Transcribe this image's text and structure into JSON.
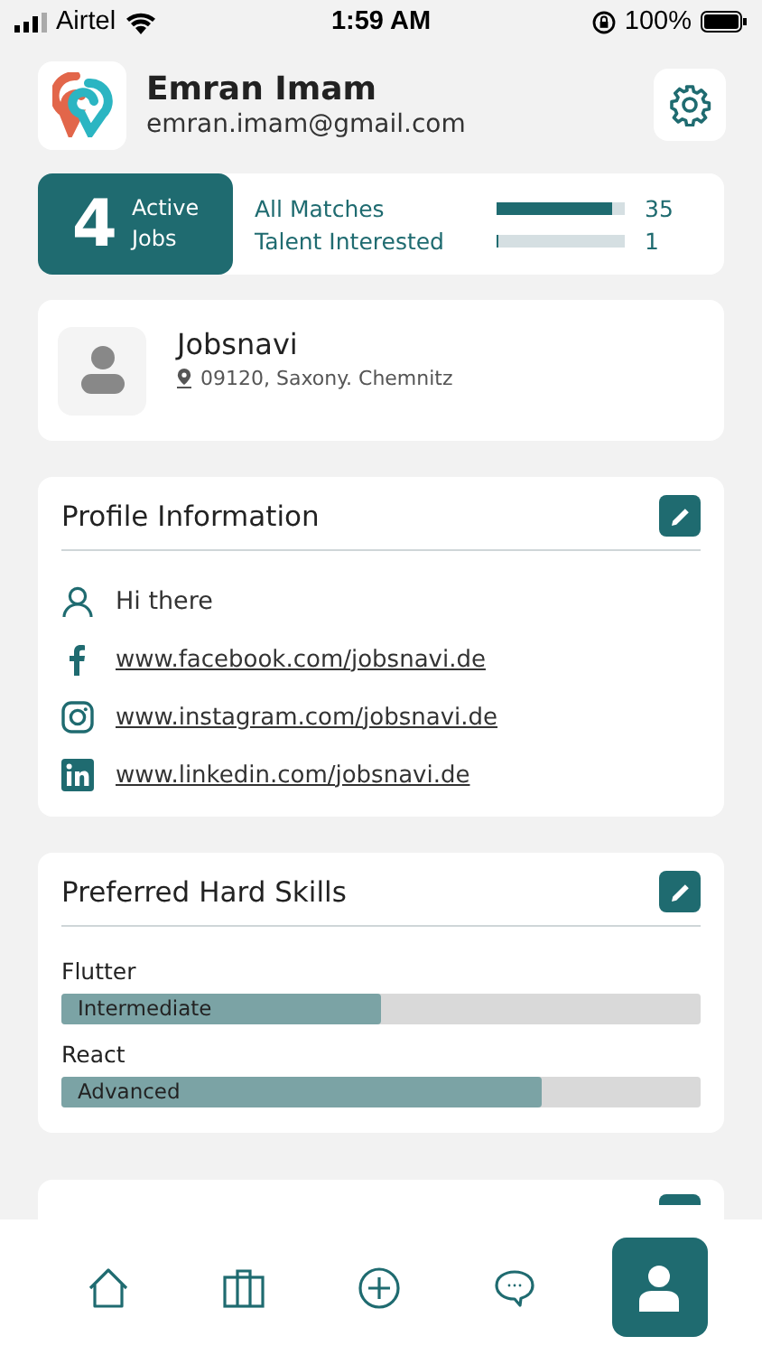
{
  "status_bar": {
    "carrier": "Airtel",
    "time": "1:59 AM",
    "battery": "100%"
  },
  "user": {
    "name": "Emran Imam",
    "email": "emran.imam@gmail.com"
  },
  "stats": {
    "active_count": "4",
    "active_label_1": "Active",
    "active_label_2": "Jobs",
    "metrics": [
      {
        "label": "All Matches",
        "level": 0.9,
        "value": "35"
      },
      {
        "label": "Talent Interested",
        "level": 0.02,
        "value": "1"
      }
    ]
  },
  "company": {
    "name": "Jobsnavi",
    "location": "09120, Saxony. Chemnitz"
  },
  "profile_info": {
    "title": "Profile Information",
    "items": [
      {
        "kind": "bio",
        "text": "Hi there"
      },
      {
        "kind": "facebook",
        "text": "www.facebook.com/jobsnavi.de"
      },
      {
        "kind": "instagram",
        "text": "www.instagram.com/jobsnavi.de"
      },
      {
        "kind": "linkedin",
        "text": "www.linkedin.com/jobsnavi.de"
      }
    ]
  },
  "hard_skills": {
    "title": "Preferred Hard Skills",
    "skills": [
      {
        "name": "Flutter",
        "level_label": "Intermediate",
        "level": 0.5
      },
      {
        "name": "React",
        "level_label": "Advanced",
        "level": 0.75
      }
    ]
  },
  "bottom_nav": [
    {
      "kind": "home",
      "selected": false
    },
    {
      "kind": "jobs",
      "selected": false
    },
    {
      "kind": "add",
      "selected": false
    },
    {
      "kind": "chat",
      "selected": false
    },
    {
      "kind": "profile",
      "selected": true
    }
  ]
}
